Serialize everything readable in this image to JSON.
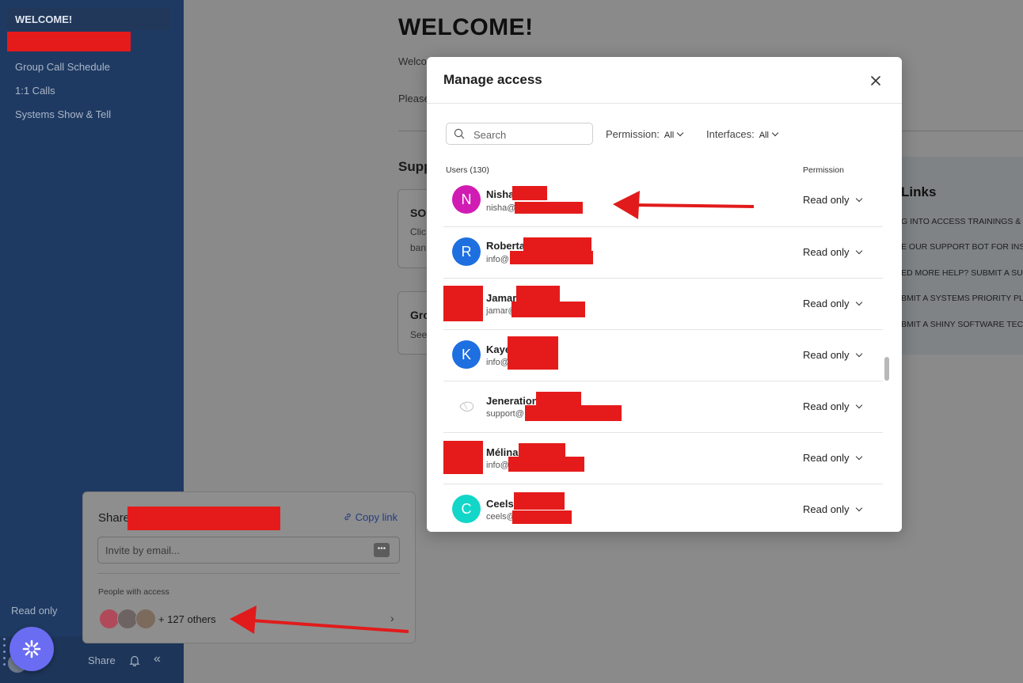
{
  "sidebar": {
    "active_item": "WELCOME!",
    "items": [
      "Group Call Schedule",
      "1:1 Calls",
      "Systems Show & Tell"
    ],
    "read_only": "Read only",
    "share_label": "Share"
  },
  "background": {
    "title": "WELCOME!",
    "welcome_text": "Welco",
    "please_text": "Please",
    "support_heading": "Supp",
    "card1": {
      "title": "SO",
      "line1": "Clic",
      "line2": "ban"
    },
    "card2": {
      "title": "Gro",
      "line1": "See"
    },
    "links": {
      "title": "Links",
      "items": [
        "G INTO ACCESS TRAININGS & T",
        "E OUR SUPPORT BOT FOR INST",
        "ED MORE HELP? SUBMIT A SU",
        "BMIT A SYSTEMS PRIORITY PLA",
        "BMIT A SHINY SOFTWARE TEC"
      ]
    }
  },
  "share_popup": {
    "title": "Share",
    "copy_link": "Copy link",
    "invite_placeholder": "Invite by email...",
    "people_with_access": "People with access",
    "others": "+ 127 others"
  },
  "modal": {
    "title": "Manage access",
    "search_placeholder": "Search",
    "filters": {
      "permission_label": "Permission:",
      "permission_value": "All",
      "interfaces_label": "Interfaces:",
      "interfaces_value": "All"
    },
    "users_header": "Users (130)",
    "permission_header": "Permission",
    "users": [
      {
        "initial": "N",
        "name": "Nisha",
        "email": "nisha@",
        "permission": "Read only",
        "color": "#d11cb4"
      },
      {
        "initial": "R",
        "name": "Roberta",
        "email": "info@",
        "permission": "Read only",
        "color": "#1e6fe0"
      },
      {
        "initial": "",
        "name": "Jamar",
        "email": "jamar@",
        "permission": "Read only",
        "color": "#e51b1b"
      },
      {
        "initial": "K",
        "name": "Kaye",
        "email": "info@",
        "permission": "Read only",
        "color": "#1e6fe0"
      },
      {
        "initial": "",
        "name": "Jeneration",
        "email": "support@",
        "permission": "Read only",
        "color": "#ffffff"
      },
      {
        "initial": "",
        "name": "Mélina",
        "email": "info@",
        "permission": "Read only",
        "color": "#e51b1b"
      },
      {
        "initial": "C",
        "name": "Ceels",
        "email": "ceels@",
        "permission": "Read only",
        "color": "#12d6c8"
      }
    ]
  },
  "colors": {
    "sidebar_bg": "#1f3a62",
    "redaction": "#e51b1b",
    "fab": "#6a6cf2",
    "annotation_arrow": "#e11b1b"
  }
}
